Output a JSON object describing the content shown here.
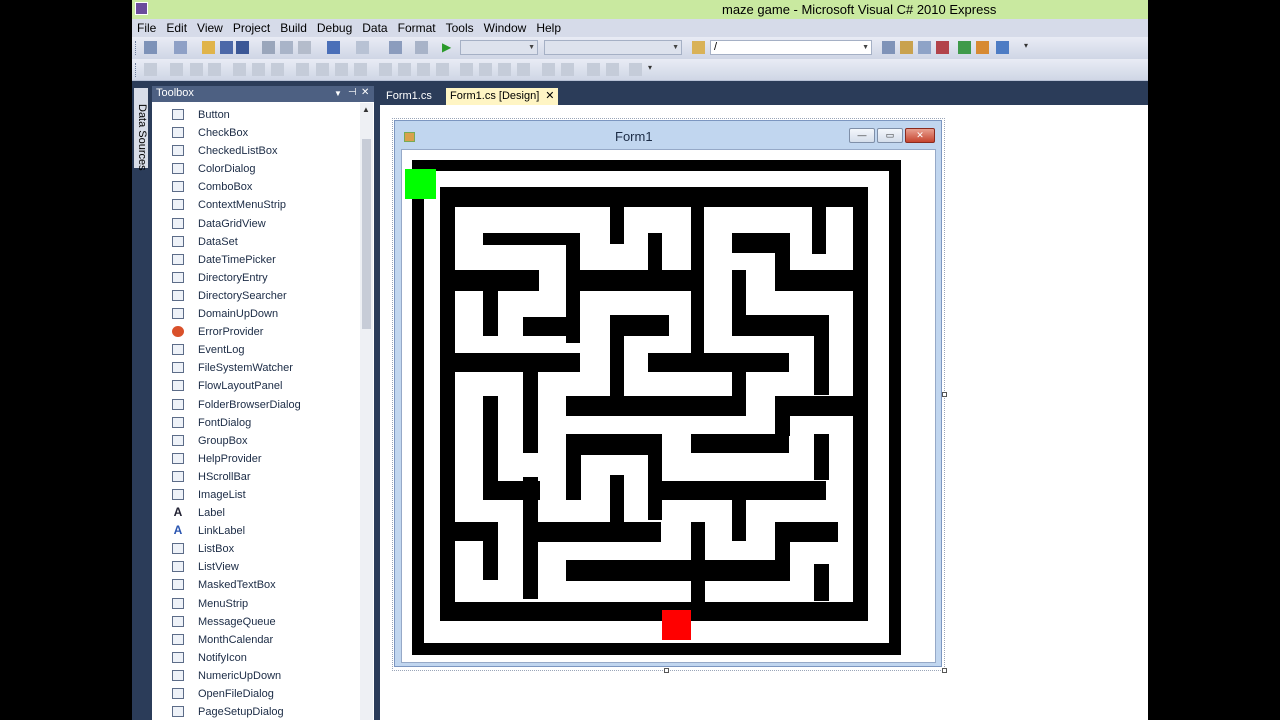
{
  "window": {
    "title": "maze game - Microsoft Visual C# 2010 Express"
  },
  "menu": [
    "File",
    "Edit",
    "View",
    "Project",
    "Build",
    "Debug",
    "Data",
    "Format",
    "Tools",
    "Window",
    "Help"
  ],
  "toolbar": {
    "find_combo_value": "/"
  },
  "side_tab": {
    "data_sources": "Data Sources"
  },
  "toolbox": {
    "title": "Toolbox",
    "items": [
      {
        "label": "Button",
        "icon": "button-icon"
      },
      {
        "label": "CheckBox",
        "icon": "checkbox-icon"
      },
      {
        "label": "CheckedListBox",
        "icon": "checkedlistbox-icon"
      },
      {
        "label": "ColorDialog",
        "icon": "colordialog-icon"
      },
      {
        "label": "ComboBox",
        "icon": "combobox-icon"
      },
      {
        "label": "ContextMenuStrip",
        "icon": "contextmenustrip-icon"
      },
      {
        "label": "DataGridView",
        "icon": "datagridview-icon"
      },
      {
        "label": "DataSet",
        "icon": "dataset-icon"
      },
      {
        "label": "DateTimePicker",
        "icon": "datetimepicker-icon"
      },
      {
        "label": "DirectoryEntry",
        "icon": "directoryentry-icon"
      },
      {
        "label": "DirectorySearcher",
        "icon": "directorysearcher-icon"
      },
      {
        "label": "DomainUpDown",
        "icon": "domainupdown-icon"
      },
      {
        "label": "ErrorProvider",
        "icon": "errorprovider-icon"
      },
      {
        "label": "EventLog",
        "icon": "eventlog-icon"
      },
      {
        "label": "FileSystemWatcher",
        "icon": "filesystemwatcher-icon"
      },
      {
        "label": "FlowLayoutPanel",
        "icon": "flowlayoutpanel-icon"
      },
      {
        "label": "FolderBrowserDialog",
        "icon": "folderbrowserdialog-icon"
      },
      {
        "label": "FontDialog",
        "icon": "fontdialog-icon"
      },
      {
        "label": "GroupBox",
        "icon": "groupbox-icon"
      },
      {
        "label": "HelpProvider",
        "icon": "helpprovider-icon"
      },
      {
        "label": "HScrollBar",
        "icon": "hscrollbar-icon"
      },
      {
        "label": "ImageList",
        "icon": "imagelist-icon"
      },
      {
        "label": "Label",
        "icon": "label-icon"
      },
      {
        "label": "LinkLabel",
        "icon": "linklabel-icon"
      },
      {
        "label": "ListBox",
        "icon": "listbox-icon"
      },
      {
        "label": "ListView",
        "icon": "listview-icon"
      },
      {
        "label": "MaskedTextBox",
        "icon": "maskedtextbox-icon"
      },
      {
        "label": "MenuStrip",
        "icon": "menustrip-icon"
      },
      {
        "label": "MessageQueue",
        "icon": "messagequeue-icon"
      },
      {
        "label": "MonthCalendar",
        "icon": "monthcalendar-icon"
      },
      {
        "label": "NotifyIcon",
        "icon": "notifyicon-icon"
      },
      {
        "label": "NumericUpDown",
        "icon": "numericupdown-icon"
      },
      {
        "label": "OpenFileDialog",
        "icon": "openfiledialog-icon"
      },
      {
        "label": "PageSetupDialog",
        "icon": "pagesetupdialog-icon"
      }
    ]
  },
  "tabs": [
    {
      "label": "Form1.cs",
      "active": false
    },
    {
      "label": "Form1.cs [Design]",
      "active": true
    }
  ],
  "form": {
    "title": "Form1"
  },
  "colors": {
    "start": "#00ff00",
    "finish": "#ff0000",
    "walls": "#000000"
  }
}
